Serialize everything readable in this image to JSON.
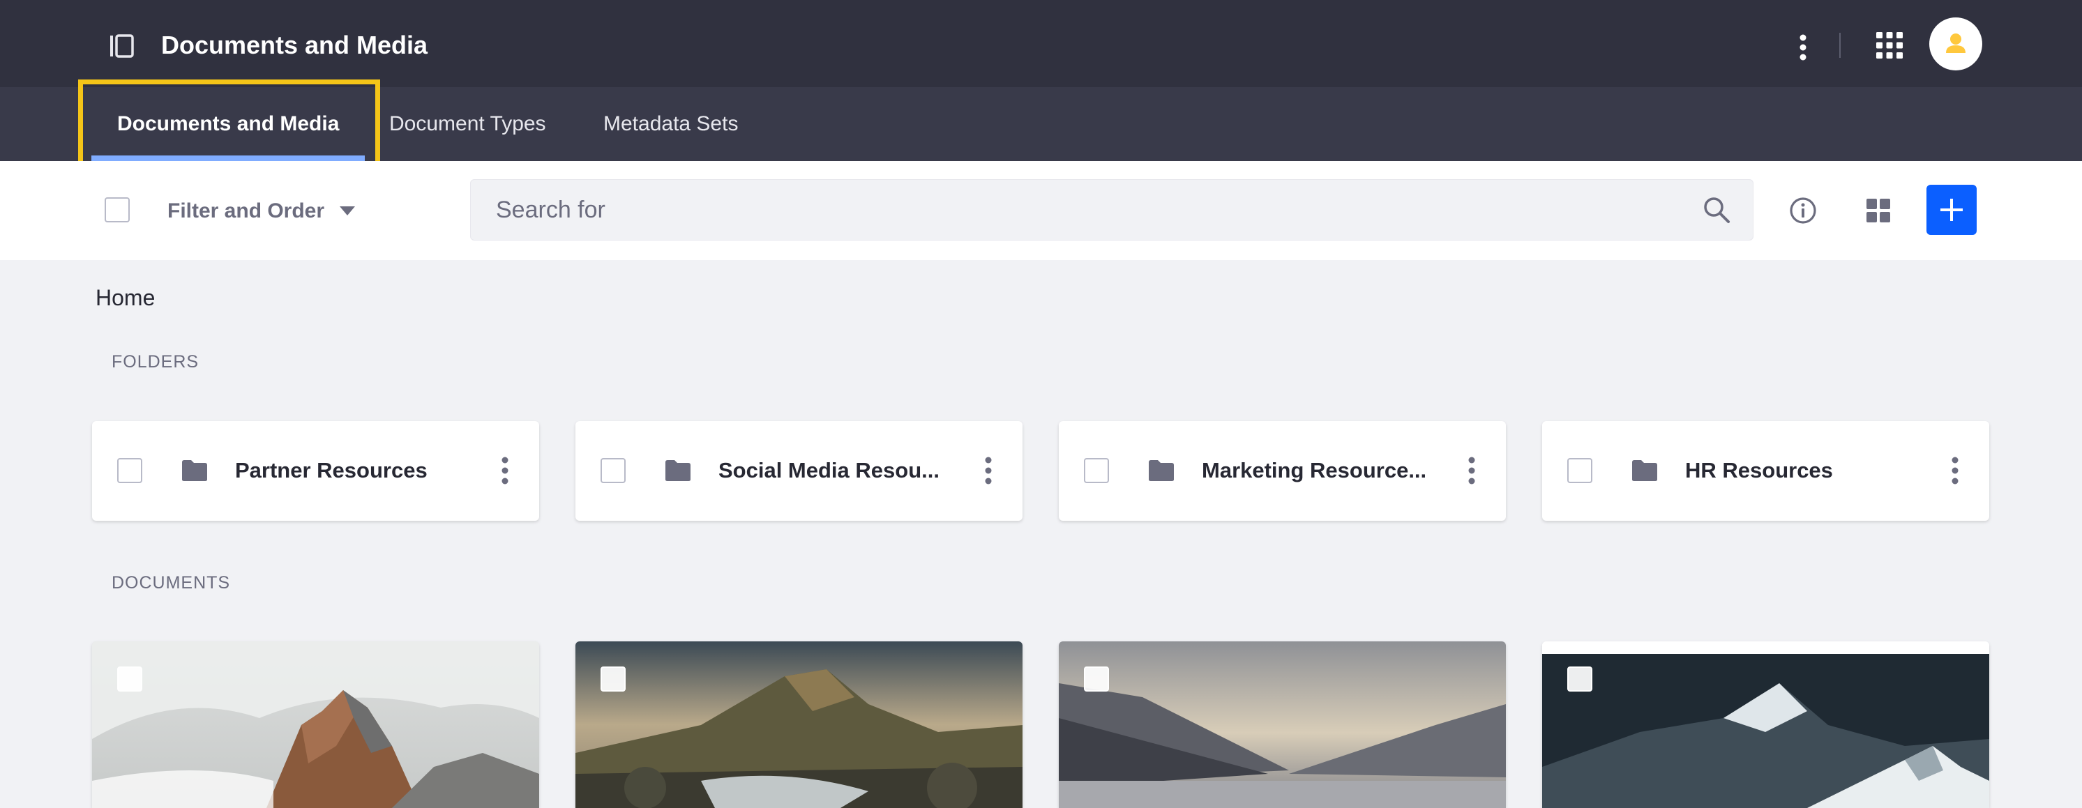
{
  "header": {
    "title": "Documents and Media"
  },
  "tabs": [
    {
      "label": "Documents and Media",
      "active": true
    },
    {
      "label": "Document Types",
      "active": false
    },
    {
      "label": "Metadata Sets",
      "active": false
    }
  ],
  "toolbar": {
    "filter_label": "Filter and Order",
    "search_placeholder": "Search for"
  },
  "breadcrumb": {
    "home": "Home"
  },
  "folders": {
    "section_title": "FOLDERS",
    "items": [
      {
        "name": "Partner Resources"
      },
      {
        "name": "Social Media Resou..."
      },
      {
        "name": "Marketing Resource..."
      },
      {
        "name": "HR Resources"
      }
    ]
  },
  "documents": {
    "section_title": "DOCUMENTS",
    "items": [
      {
        "thumbnail": "misty-rocky-mountain"
      },
      {
        "thumbnail": "mountain-stream-sunset"
      },
      {
        "thumbnail": "lake-valley-dusk"
      },
      {
        "thumbnail": "snowy-peak-night"
      }
    ]
  },
  "colors": {
    "topbar": "#30313f",
    "subnav": "#393a4a",
    "accent": "#0b5fff",
    "tab_underline": "#80acff",
    "highlight": "#f5c518"
  }
}
